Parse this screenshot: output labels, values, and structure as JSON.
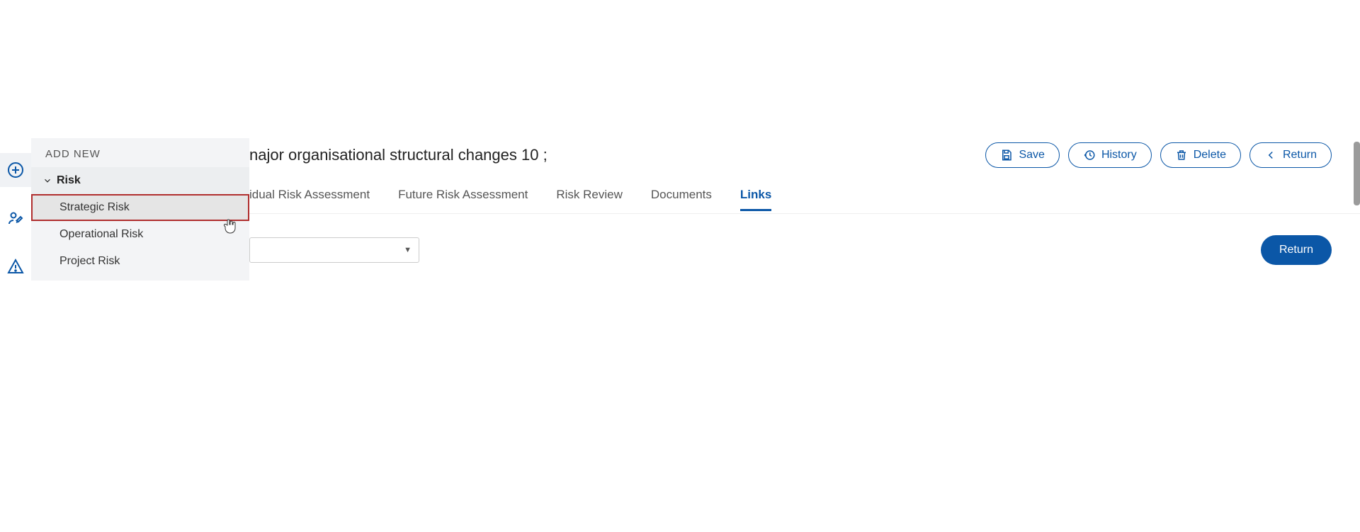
{
  "sidebar": {
    "icons": [
      "plus",
      "user-edit",
      "warning"
    ]
  },
  "addnew": {
    "title": "ADD NEW",
    "category": "Risk",
    "items": [
      {
        "label": "Strategic Risk",
        "hovered": true
      },
      {
        "label": "Operational Risk",
        "hovered": false
      },
      {
        "label": "Project Risk",
        "hovered": false
      }
    ]
  },
  "header": {
    "title": "najor organisational structural changes 10 ;",
    "actions": {
      "save": "Save",
      "history": "History",
      "delete": "Delete",
      "return": "Return"
    }
  },
  "tabs": [
    {
      "label": "idual Risk Assessment",
      "active": false
    },
    {
      "label": "Future Risk Assessment",
      "active": false
    },
    {
      "label": "Risk Review",
      "active": false
    },
    {
      "label": "Documents",
      "active": false
    },
    {
      "label": "Links",
      "active": true
    }
  ],
  "body": {
    "select_placeholder": "",
    "return_button": "Return"
  }
}
